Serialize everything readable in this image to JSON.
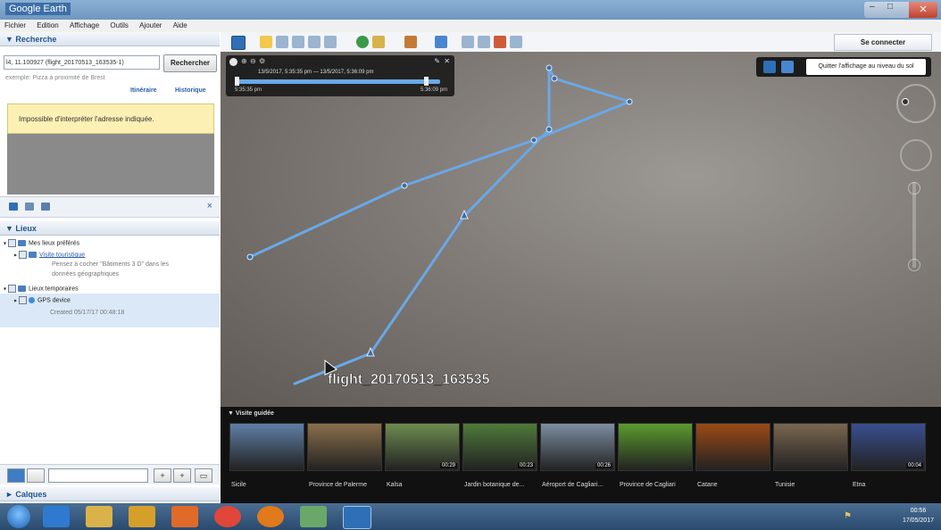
{
  "window": {
    "title": "Google Earth"
  },
  "menu": [
    "Fichier",
    "Edition",
    "Affichage",
    "Outils",
    "Ajouter",
    "Aide"
  ],
  "search": {
    "header": "▼ Recherche",
    "input_value": "l4, 11.100927 (flight_20170513_163535-1)",
    "button": "Rechercher",
    "example": "exemple: Pizza à proximité de Brest",
    "route_link": "Itinéraire",
    "history_link": "Historique",
    "error": "Impossible d'interpréter l'adresse indiquée."
  },
  "places": {
    "header": "▼ Lieux",
    "close": "×",
    "items": [
      {
        "label": "Mes lieux préférés"
      },
      {
        "label": "Visite touristique"
      },
      {
        "label": "Pensez à cocher \"Bâtiments 3 D\" dans les"
      },
      {
        "label": "données géographiques"
      },
      {
        "label": "Lieux temporaires"
      },
      {
        "label": "GPS device"
      },
      {
        "label": "Created 05/17/17 00:48:18"
      }
    ]
  },
  "layers": {
    "header": "► Calques"
  },
  "toolbar": {
    "signin": "Se connecter"
  },
  "viewport": {
    "track_label": "flight_20170513_163535",
    "time_start": "13/5/2017, 5:35:35 pm",
    "time_end": "13/5/2017, 5:36:09 pm",
    "time_left": "5:35:35 pm",
    "time_right": "5:36:09 pm",
    "exit_ground": "Quitter l'affichage au niveau du sol"
  },
  "tour": {
    "header": "▼ Visite guidée",
    "items": [
      {
        "label": "Sicile",
        "duration": "",
        "color": "#5f7fa6"
      },
      {
        "label": "Province de Palerme",
        "duration": "",
        "color": "#8a6f4a"
      },
      {
        "label": "Kalsa",
        "duration": "00:29",
        "color": "#6d8c4f"
      },
      {
        "label": "Jardin botanique de...",
        "duration": "00:23",
        "color": "#4f7a3a"
      },
      {
        "label": "Aéroport de Cagliari...",
        "duration": "00:26",
        "color": "#7c8da0"
      },
      {
        "label": "Province de Cagliari",
        "duration": "",
        "color": "#5b9a2e"
      },
      {
        "label": "Catane",
        "duration": "",
        "color": "#9a4a16"
      },
      {
        "label": "Tunisie",
        "duration": "",
        "color": "#7a6650"
      },
      {
        "label": "Etna",
        "duration": "00:04",
        "color": "#3a4f8f"
      }
    ]
  },
  "taskbar": {
    "time": "00:56",
    "date": "17/05/2017"
  },
  "colors": {
    "track": "#6aa8e8",
    "panel_bg": "#dbe8f7",
    "error_bg": "#fcf0b5"
  }
}
